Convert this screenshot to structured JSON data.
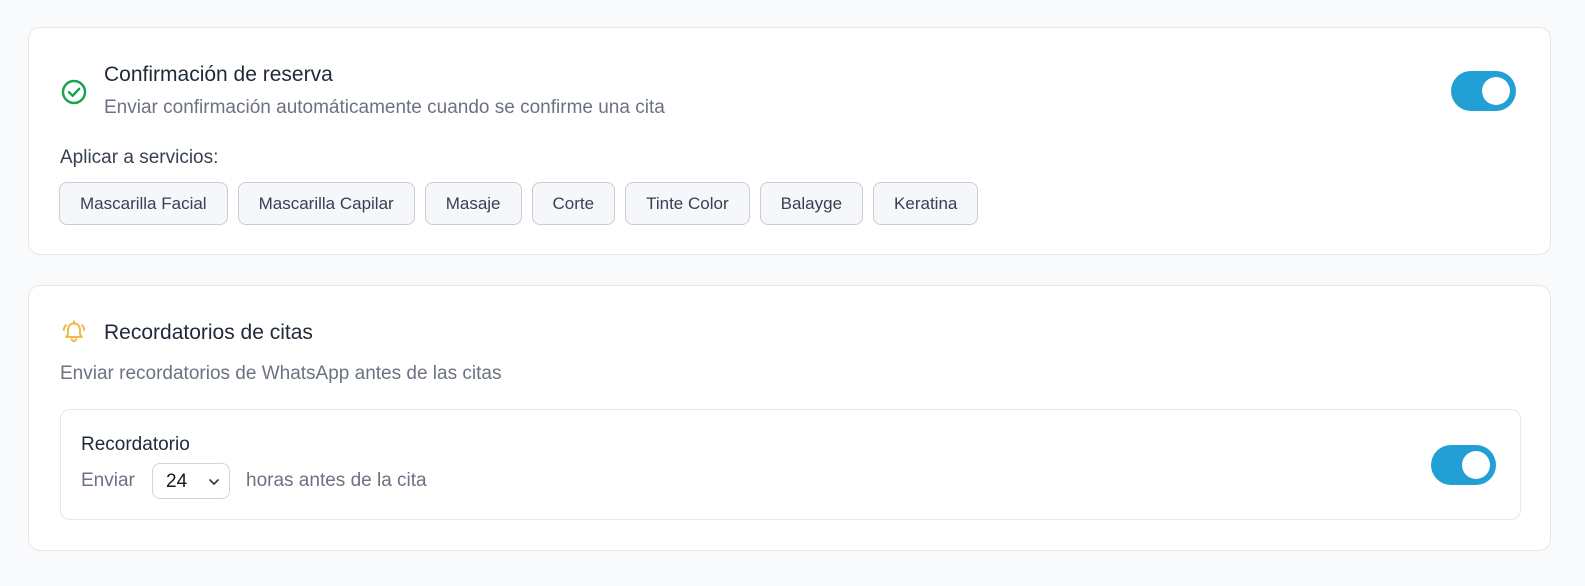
{
  "colors": {
    "toggle_on": "#22a0d6",
    "check_green": "#16a34a",
    "bell_amber": "#f2b94a"
  },
  "booking_confirmation": {
    "icon": "check-circle-icon",
    "title": "Confirmación de reserva",
    "description": "Enviar confirmación automáticamente cuando se confirme una cita",
    "enabled": true,
    "apply_label": "Aplicar a servicios:",
    "services": [
      "Mascarilla Facial",
      "Mascarilla Capilar",
      "Masaje",
      "Corte",
      "Tinte Color",
      "Balayge",
      "Keratina"
    ]
  },
  "appointment_reminders": {
    "icon": "bell-icon",
    "title": "Recordatorios de citas",
    "description": "Enviar recordatorios de WhatsApp antes de las citas",
    "reminder": {
      "label": "Recordatorio",
      "send_prefix": "Enviar",
      "hours_value": "24",
      "send_suffix": "horas antes de la cita",
      "enabled": true
    }
  }
}
